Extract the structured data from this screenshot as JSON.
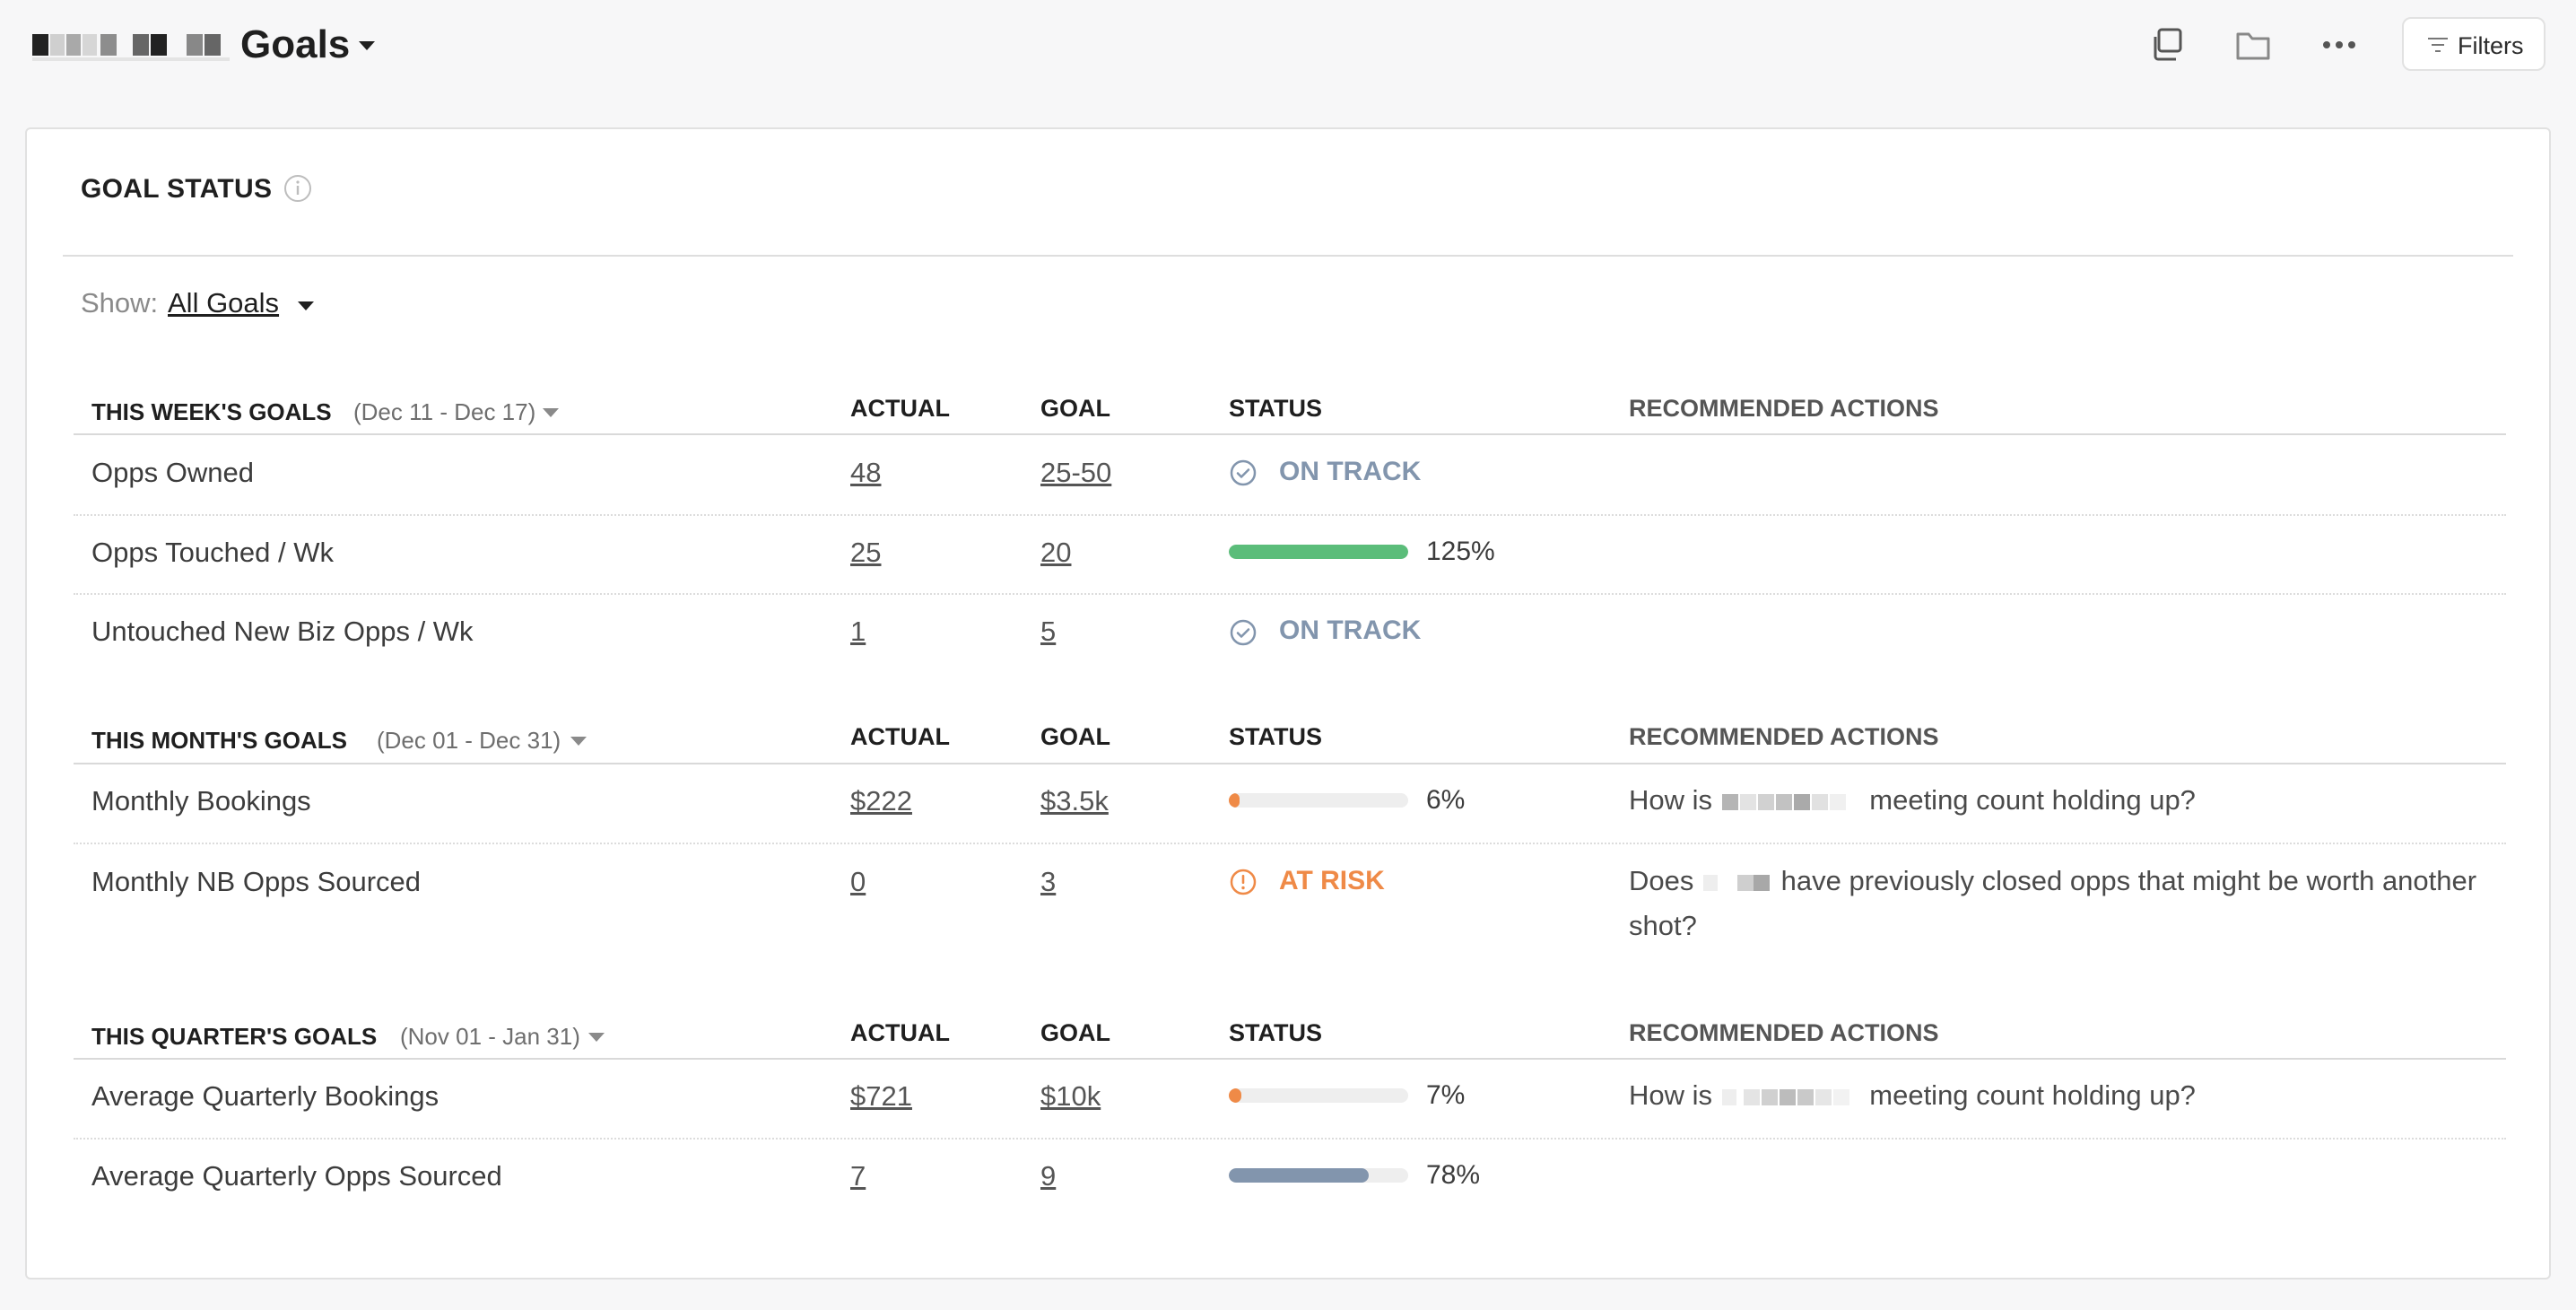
{
  "header": {
    "title": "Goals",
    "filters_label": "Filters",
    "icons": [
      "copy-icon",
      "folder-icon",
      "more-icon",
      "filter-icon"
    ]
  },
  "card": {
    "title": "GOAL STATUS",
    "show_label": "Show:",
    "show_value": "All Goals"
  },
  "columns": {
    "actual": "ACTUAL",
    "goal": "GOAL",
    "status": "STATUS",
    "recommended": "RECOMMENDED ACTIONS"
  },
  "sections": [
    {
      "title": "THIS WEEK'S GOALS",
      "range": "(Dec 11 - Dec 17)",
      "rows": [
        {
          "name": "Opps Owned",
          "actual": "48",
          "goal": "25-50",
          "status_type": "on_track",
          "status_text": "ON TRACK",
          "rec": ""
        },
        {
          "name": "Opps Touched / Wk",
          "actual": "25",
          "goal": "20",
          "status_type": "bar",
          "progress": 1.25,
          "bar_color": "#5bbd7a",
          "pct": "125%",
          "rec": ""
        },
        {
          "name": "Untouched New Biz Opps / Wk",
          "actual": "1",
          "goal": "5",
          "status_type": "on_track",
          "status_text": "ON TRACK",
          "rec": ""
        }
      ]
    },
    {
      "title": "THIS MONTH'S GOALS",
      "range": "(Dec 01 - Dec 31)",
      "rows": [
        {
          "name": "Monthly Bookings",
          "actual": "$222",
          "goal": "$3.5k",
          "status_type": "bar",
          "progress": 0.06,
          "bar_color": "#ef8a47",
          "pct": "6%",
          "rec_a": "How is",
          "rec_b": "meeting count holding up?"
        },
        {
          "name": "Monthly NB Opps Sourced",
          "actual": "0",
          "goal": "3",
          "status_type": "at_risk",
          "status_text": "AT RISK",
          "rec_a": "Does",
          "rec_b": "have previously closed opps that might be worth another",
          "rec_c": "shot?"
        }
      ]
    },
    {
      "title": "THIS QUARTER'S GOALS",
      "range": "(Nov 01 - Jan 31)",
      "rows": [
        {
          "name": "Average Quarterly Bookings",
          "actual": "$721",
          "goal": "$10k",
          "status_type": "bar",
          "progress": 0.07,
          "bar_color": "#ef8a47",
          "pct": "7%",
          "rec_a": "How is",
          "rec_b": "meeting count holding up?"
        },
        {
          "name": "Average Quarterly Opps Sourced",
          "actual": "7",
          "goal": "9",
          "status_type": "bar",
          "progress": 0.78,
          "bar_color": "#8295ad",
          "pct": "78%",
          "rec": ""
        }
      ]
    }
  ],
  "colors": {
    "on_track": "#8295ad",
    "at_risk": "#ef8a47",
    "bar_green": "#5bbd7a",
    "bar_orange": "#ef8a47",
    "bar_slate": "#8295ad"
  }
}
